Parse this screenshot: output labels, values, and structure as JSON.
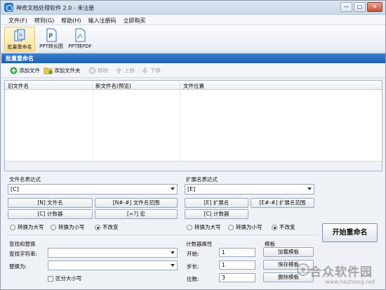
{
  "window": {
    "title": "神奇文档处理软件 2.0 - 未注册",
    "buttons": {
      "minimize": "—",
      "maximize": "□",
      "close": "✕"
    }
  },
  "menu": [
    "文件(F)",
    "转到(G)",
    "帮助(H)",
    "输入注册码",
    "立即购买"
  ],
  "toolbar": {
    "tools": [
      {
        "label": "批量重命名",
        "icon": "rename-icon",
        "selected": true
      },
      {
        "label": "PPT转长图",
        "icon": "ppt-icon",
        "selected": false
      },
      {
        "label": "PPT转PDF",
        "icon": "pdf-icon",
        "selected": false
      }
    ]
  },
  "section_title": "批量重命名",
  "actions": {
    "add_file": "添加文件",
    "add_folder": "添加文件夹",
    "remove": "移除",
    "move_up": "上移",
    "move_down": "下移"
  },
  "grid": {
    "columns": [
      "旧文件名",
      "新文件名(预览)",
      "文件位置"
    ]
  },
  "filename_expr": {
    "title": "文件名表达式",
    "value": "[C]",
    "buttons": [
      "[N] 文件名",
      "[N#-#] 文件名范围",
      "[C] 计数器",
      "[=?] 宏"
    ],
    "radios": [
      "转换为大写",
      "转换为小写",
      "不改变"
    ],
    "selected_radio": "不改变"
  },
  "ext_expr": {
    "title": "扩展名表达式",
    "value": "[E]",
    "buttons": [
      "[E] 扩展名",
      "[E#-#] 扩展名范围",
      "[C] 计数器"
    ],
    "radios": [
      "转换为大写",
      "转换为小写",
      "不改变"
    ],
    "selected_radio": "不改变"
  },
  "find_replace": {
    "title": "查找和替换",
    "find_label": "查找字符串:",
    "replace_label": "替换为:",
    "case_label": "区分大小写"
  },
  "counter": {
    "title": "计数器属性",
    "start_label": "开始:",
    "start_value": "1",
    "step_label": "步长:",
    "step_value": "1",
    "digits_label": "位数:",
    "digits_value": "3"
  },
  "template": {
    "title": "模板",
    "load": "加载模板",
    "save": "保存模板",
    "delete": "删除模板"
  },
  "start_button": "开始重命名",
  "watermark": {
    "text": "合众软件园",
    "url": "www.hezhong.net"
  }
}
